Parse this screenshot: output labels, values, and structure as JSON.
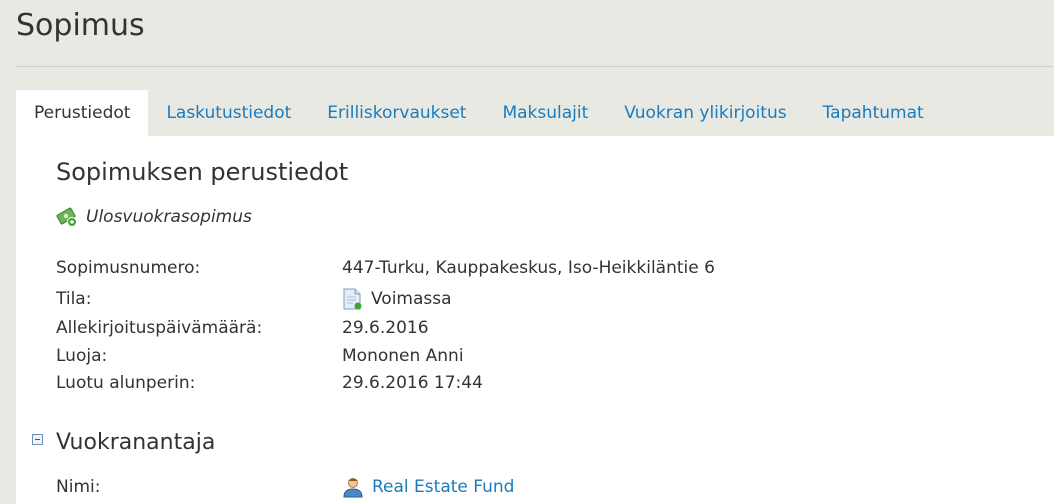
{
  "page": {
    "title": "Sopimus"
  },
  "tabs": [
    {
      "label": "Perustiedot",
      "active": true
    },
    {
      "label": "Laskutustiedot"
    },
    {
      "label": "Erilliskorvaukset"
    },
    {
      "label": "Maksulajit"
    },
    {
      "label": "Vuokran ylikirjoitus"
    },
    {
      "label": "Tapahtumat"
    }
  ],
  "basic_info": {
    "title": "Sopimuksen perustiedot",
    "contract_type": {
      "label": "Ulosvuokrasopimus",
      "icon": "money-icon"
    },
    "fields": [
      {
        "label": "Sopimusnumero:",
        "value": "447-Turku, Kauppakeskus, Iso-Heikkiläntie 6"
      },
      {
        "label": "Tila:",
        "value": "Voimassa",
        "icon": "document-icon"
      },
      {
        "label": "Allekirjoituspäivämäärä:",
        "value": "29.6.2016"
      },
      {
        "label": "Luoja:",
        "value": "Mononen Anni"
      },
      {
        "label": "Luotu alunperin:",
        "value": "29.6.2016 17:44"
      }
    ]
  },
  "landlord": {
    "title": "Vuokranantaja",
    "fields": [
      {
        "label": "Nimi:",
        "value": "Real Estate Fund",
        "icon": "person-icon"
      }
    ]
  }
}
